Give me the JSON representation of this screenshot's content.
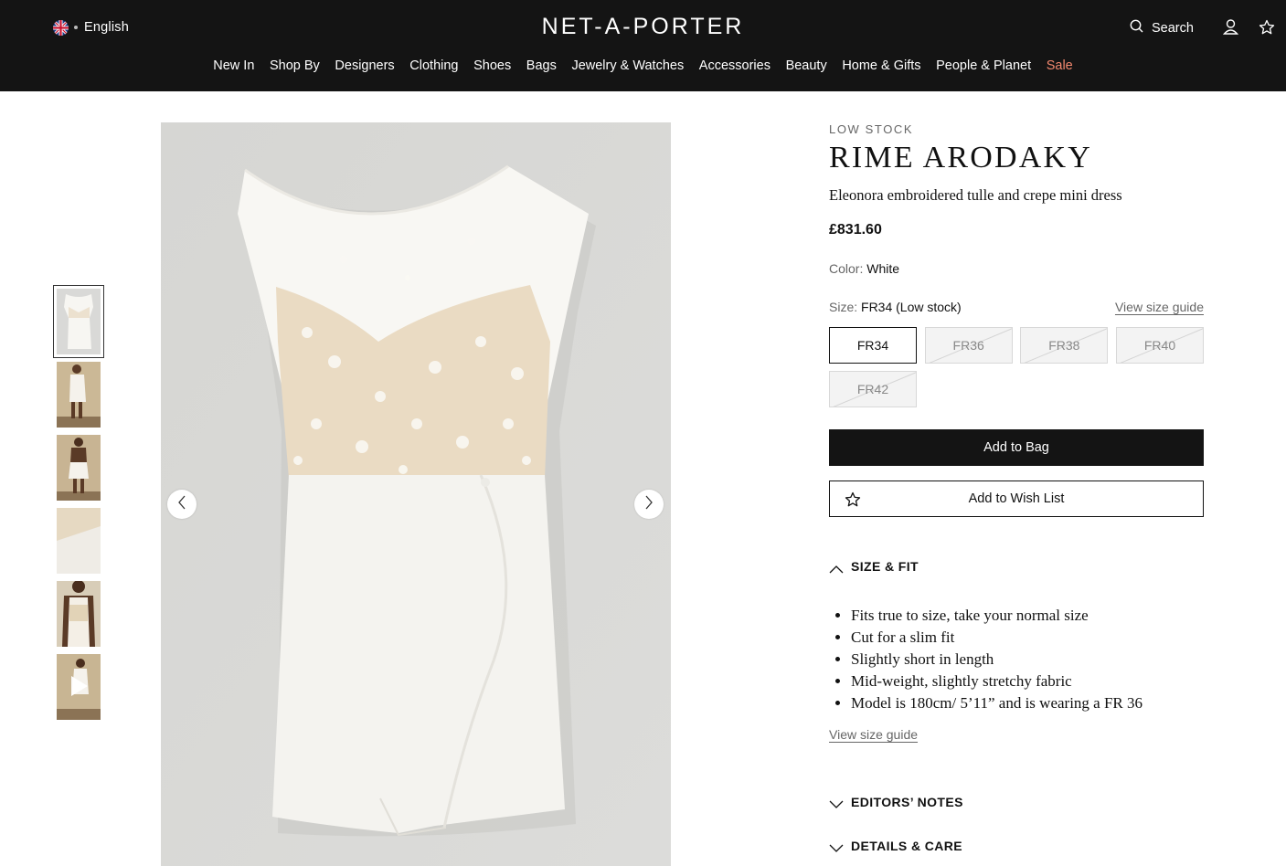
{
  "header": {
    "language": "English",
    "logo": "NET-A-PORTER",
    "search_label": "Search",
    "nav": [
      {
        "label": "New In"
      },
      {
        "label": "Shop By"
      },
      {
        "label": "Designers"
      },
      {
        "label": "Clothing"
      },
      {
        "label": "Shoes"
      },
      {
        "label": "Bags"
      },
      {
        "label": "Jewelry & Watches"
      },
      {
        "label": "Accessories"
      },
      {
        "label": "Beauty"
      },
      {
        "label": "Home & Gifts"
      },
      {
        "label": "People & Planet"
      },
      {
        "label": "Sale"
      }
    ]
  },
  "product": {
    "stock_badge": "LOW STOCK",
    "designer": "RIME ARODAKY",
    "name": "Eleonora embroidered tulle and crepe mini dress",
    "price": "£831.60",
    "color_label": "Color:",
    "color_value": "White",
    "size_label": "Size:",
    "size_value": "FR34 (Low stock)",
    "size_guide": "View size guide",
    "sizes": [
      {
        "label": "FR34",
        "available": true,
        "selected": true
      },
      {
        "label": "FR36",
        "available": false,
        "selected": false
      },
      {
        "label": "FR38",
        "available": false,
        "selected": false
      },
      {
        "label": "FR40",
        "available": false,
        "selected": false
      },
      {
        "label": "FR42",
        "available": false,
        "selected": false
      }
    ],
    "add_to_bag": "Add to Bag",
    "add_to_wishlist": "Add to Wish List"
  },
  "accordion": {
    "size_fit": {
      "title": "SIZE & FIT",
      "expanded": true,
      "bullets": [
        "Fits true to size, take your normal size",
        "Cut for a slim fit",
        "Slightly short in length",
        "Mid-weight, slightly stretchy fabric",
        "Model is 180cm/ 5’11” and is wearing a FR 36"
      ],
      "size_guide_link": "View size guide"
    },
    "editors_notes": {
      "title": "EDITORS’ NOTES",
      "expanded": false
    },
    "details_care": {
      "title": "DETAILS & CARE",
      "expanded": false
    }
  },
  "gallery": {
    "thumbnails": [
      "product-front",
      "model-front",
      "model-back",
      "detail-closeup",
      "model-closeup",
      "video"
    ],
    "active_index": 0
  },
  "colors": {
    "header_bg": "#141414",
    "sale": "#f3886e",
    "image_bg": "#d9d9d7"
  }
}
